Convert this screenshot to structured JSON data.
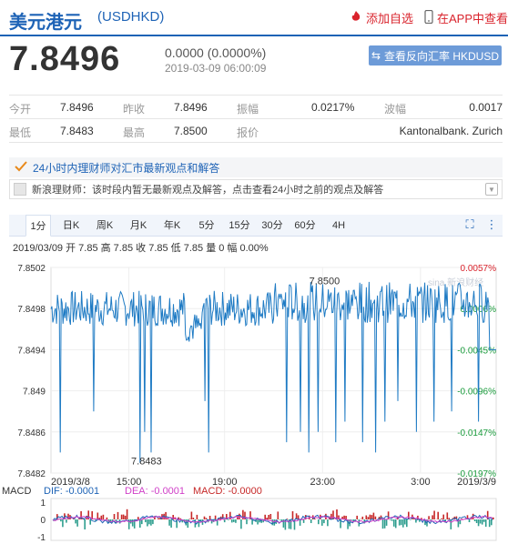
{
  "header": {
    "title": "美元港元",
    "code": "(USDHKD)",
    "add_fav": "添加自选",
    "app_view": "在APP中查看"
  },
  "quote": {
    "price": "7.8496",
    "change": "0.0000 (0.0000%)",
    "time": "2019-03-09 06:00:09",
    "reverse_button": "查看反向汇率 HKDUSD"
  },
  "stats": {
    "open_label": "今开",
    "open": "7.8496",
    "prev_label": "昨收",
    "prev": "7.8496",
    "amp_label": "振幅",
    "amp": "0.0217%",
    "wave_label": "波幅",
    "wave": "0.0017",
    "low_label": "最低",
    "low": "7.8483",
    "high_label": "最高",
    "high": "7.8500",
    "quote_label": "报价",
    "quote_src": "Kantonalbank. Zurich"
  },
  "opinions": {
    "heading": "24小时内理财师对汇市最新观点和解答",
    "notice": "新浪理财师：该时段内暂无最新观点及解答，点击查看24小时之前的观点及解答"
  },
  "tabs": [
    "1分",
    "日K",
    "周K",
    "月K",
    "年K",
    "5分",
    "15分",
    "30分",
    "60分",
    "4H"
  ],
  "active_tab": "1分",
  "chart_info": "2019/03/09  开 7.85  高 7.85  收 7.85  低 7.85  量 0  幅 0.00%",
  "watermark": "sina 新浪财经",
  "colors": {
    "line": "#1f7bc4",
    "pct_up": "#d9232c",
    "pct_down": "#1a9b3c",
    "macd_dif": "#1e63b6",
    "macd_dea": "#d040c8",
    "macd_bar_up": "#c62828",
    "macd_bar_down": "#2f9e8f"
  },
  "chart_data": {
    "type": "line",
    "y_ticks": [
      "7.8502",
      "7.8498",
      "7.8494",
      "7.849",
      "7.8486",
      "7.8482"
    ],
    "ylim": [
      7.8482,
      7.8502
    ],
    "pct_ticks": [
      "0.0057%",
      "0.0006%",
      "-0.0045%",
      "-0.0096%",
      "-0.0147%",
      "-0.0197%"
    ],
    "x_ticks": [
      "2019/3/8",
      "15:00",
      "19:00",
      "23:00",
      "3:00",
      "2019/3/9"
    ],
    "annotations": {
      "high": "7.8500",
      "low": "7.8483"
    },
    "baseline": 7.8498,
    "spikes_down": [
      {
        "x": 0.02,
        "y": 7.8484
      },
      {
        "x": 0.095,
        "y": 7.8488
      },
      {
        "x": 0.2,
        "y": 7.8483
      },
      {
        "x": 0.21,
        "y": 7.8486
      },
      {
        "x": 0.225,
        "y": 7.8484
      },
      {
        "x": 0.345,
        "y": 7.8489
      },
      {
        "x": 0.355,
        "y": 7.8484
      },
      {
        "x": 0.53,
        "y": 7.8485
      },
      {
        "x": 0.56,
        "y": 7.8486
      },
      {
        "x": 0.58,
        "y": 7.8484
      },
      {
        "x": 0.6,
        "y": 7.8486
      },
      {
        "x": 0.64,
        "y": 7.8485
      },
      {
        "x": 0.66,
        "y": 7.8487
      },
      {
        "x": 0.7,
        "y": 7.8485
      },
      {
        "x": 0.73,
        "y": 7.8484
      },
      {
        "x": 0.75,
        "y": 7.8487
      },
      {
        "x": 0.78,
        "y": 7.8489
      },
      {
        "x": 0.82,
        "y": 7.8486
      },
      {
        "x": 0.86,
        "y": 7.8487
      },
      {
        "x": 0.9,
        "y": 7.8488
      },
      {
        "x": 0.96,
        "y": 7.8487
      }
    ],
    "macd": {
      "label": "MACD",
      "dif": "DIF: -0.0001",
      "dea": "DEA: -0.0001",
      "macd": "MACD: -0.0000",
      "y_ticks": [
        "1",
        "0",
        "-1"
      ]
    }
  }
}
